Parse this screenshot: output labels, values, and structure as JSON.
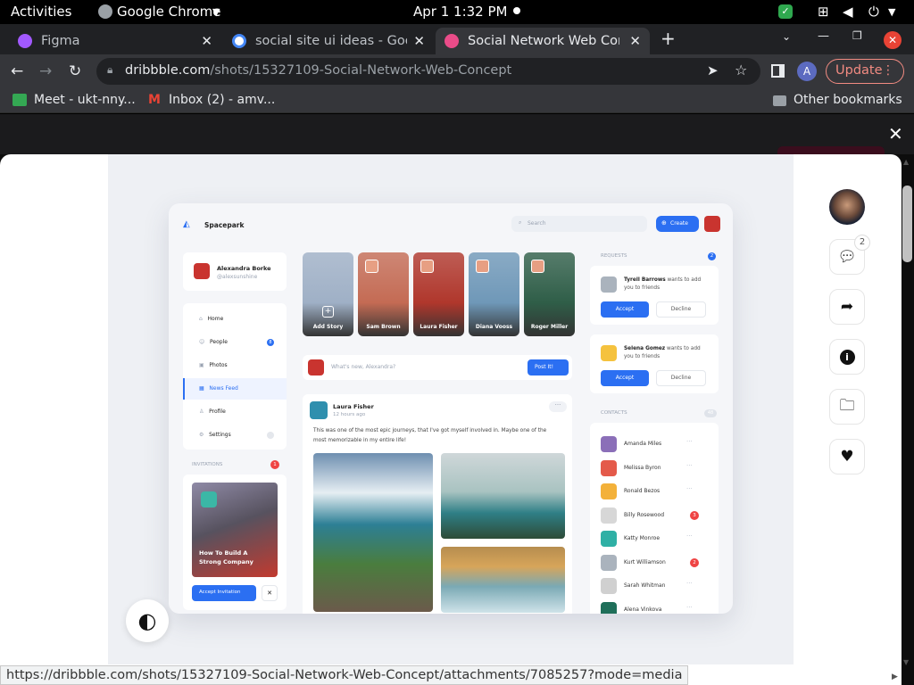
{
  "topbar": {
    "activities": "Activities",
    "app_name": "Google Chrome",
    "clock": "Apr 1  1:32 PM"
  },
  "tabs": [
    {
      "title": "Figma",
      "fav_color": "#a259ff"
    },
    {
      "title": "social site ui ideas - Googl",
      "fav_color": "#4285f4"
    },
    {
      "title": "Social Network Web Conc",
      "fav_color": "#ea4c89"
    }
  ],
  "omnibox": {
    "domain": "dribbble.com",
    "path": "/shots/15327109-Social-Network-Web-Concept"
  },
  "profile_initial": "A",
  "update_label": "Update",
  "bookmarks": [
    {
      "label": "Meet - ukt-nny..."
    },
    {
      "label": "Inbox (2) - amv..."
    }
  ],
  "other_bookmarks": "Other bookmarks",
  "rail": {
    "comment_count": "2"
  },
  "status_url": "https://dribbble.com/shots/15327109-Social-Network-Web-Concept/attachments/7085257?mode=media",
  "mock": {
    "brand": "Spacepark",
    "search_placeholder": "Search",
    "create_label": "Create",
    "profile_name": "Alexandra Borke",
    "profile_handle": "@alexsunshine",
    "menu": [
      "Home",
      "People",
      "Photos",
      "News Feed",
      "Profile",
      "Settings"
    ],
    "people_badge": "8",
    "invitations_title": "INVITATIONS",
    "invitations_badge": "1",
    "invite_caption": "How To Build A Strong Company",
    "accept_invitation": "Accept Invitation",
    "stories": [
      {
        "name": "Add Story",
        "color": "#9fb0c6"
      },
      {
        "name": "Sam Brown",
        "color": "#c46b54"
      },
      {
        "name": "Laura Fisher",
        "color": "#b0372c"
      },
      {
        "name": "Diana Vooss",
        "color": "#6f98b8"
      },
      {
        "name": "Roger Miller",
        "color": "#2f5e48"
      }
    ],
    "compose_placeholder": "What's new, Alexandra?",
    "post_button": "Post It!",
    "post_author": "Laura Fisher",
    "post_time": "12 hours ago",
    "post_text_1": "This was one of the most epic journeys, that I've got myself involved in. Maybe one of the",
    "post_text_2": "most memorizable in my entire life!",
    "requests_title": "REQUESTS",
    "requests_badge": "2",
    "requests": [
      {
        "name": "Tyrell Barrows",
        "text": "wants to add",
        "text2": "you to friends",
        "accept": "Accept",
        "decline": "Decline"
      },
      {
        "name": "Selena Gomez",
        "text": "wants to add",
        "text2": "you to friends",
        "accept": "Accept",
        "decline": "Decline"
      }
    ],
    "contacts_title": "CONTACTS",
    "contacts_badge": "48",
    "contacts": [
      {
        "name": "Amanda Miles",
        "badge": ""
      },
      {
        "name": "Melissa Byron",
        "badge": ""
      },
      {
        "name": "Ronald Bezos",
        "badge": ""
      },
      {
        "name": "Billy Rosewood",
        "badge": "3"
      },
      {
        "name": "Katty Monroe",
        "badge": ""
      },
      {
        "name": "Kurt Williamson",
        "badge": "2"
      },
      {
        "name": "Sarah Whitman",
        "badge": ""
      },
      {
        "name": "Alena Vinkova",
        "badge": ""
      }
    ]
  }
}
